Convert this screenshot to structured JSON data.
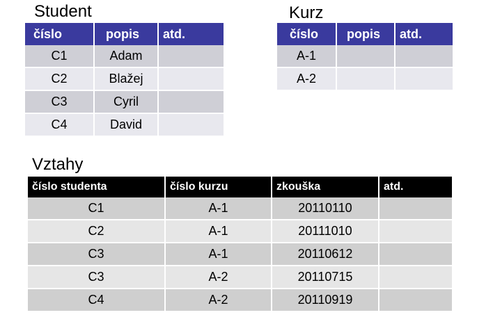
{
  "student": {
    "title": "Student",
    "headers": [
      "číslo",
      "popis",
      "atd."
    ],
    "rows": [
      [
        "C1",
        "Adam",
        ""
      ],
      [
        "C2",
        "Blažej",
        ""
      ],
      [
        "C3",
        "Cyril",
        ""
      ],
      [
        "C4",
        "David",
        ""
      ]
    ]
  },
  "kurz": {
    "title": "Kurz",
    "headers": [
      "číslo",
      "popis",
      "atd."
    ],
    "rows": [
      [
        "A-1",
        "",
        ""
      ],
      [
        "A-2",
        "",
        ""
      ]
    ]
  },
  "vztahy": {
    "title": "Vztahy",
    "headers": [
      "číslo studenta",
      "číslo kurzu",
      "zkouška",
      "atd."
    ],
    "rows": [
      [
        "C1",
        "A-1",
        "20110110",
        ""
      ],
      [
        "C2",
        "A-1",
        "20111010",
        ""
      ],
      [
        "C3",
        "A-1",
        "20110612",
        ""
      ],
      [
        "C3",
        "A-2",
        "20110715",
        ""
      ],
      [
        "C4",
        "A-2",
        "20110919",
        ""
      ]
    ]
  },
  "colors": {
    "header_blue": "#3a3a9e",
    "header_black": "#000000",
    "row_dark": "#cfcfd6",
    "row_light": "#e8e8ee"
  }
}
